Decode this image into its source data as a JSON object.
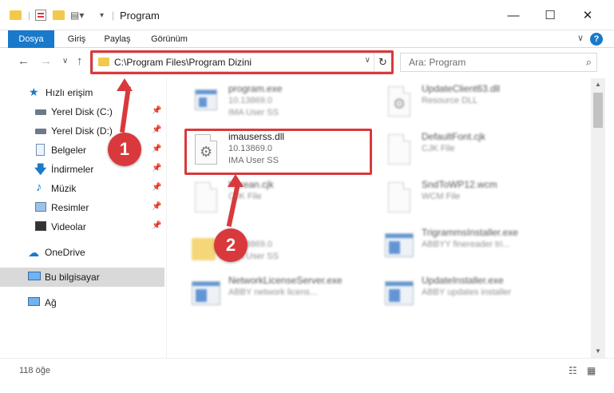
{
  "window": {
    "title": "Program",
    "minimize": "—",
    "maximize": "☐",
    "close": "✕"
  },
  "ribbon": {
    "tabs": [
      "Dosya",
      "Giriş",
      "Paylaş",
      "Görünüm"
    ],
    "help": "?",
    "collapse": "∨"
  },
  "nav": {
    "back": "←",
    "forward": "→",
    "recent": "∨",
    "up": "↑",
    "address": "C:\\Program Files\\Program Dizini",
    "search_placeholder": "Ara: Program"
  },
  "sidebar": {
    "items": [
      {
        "label": "Hızlı erişim",
        "icon": "star-icon"
      },
      {
        "label": "Yerel Disk (C:)",
        "icon": "drive-icon",
        "pinned": true
      },
      {
        "label": "Yerel Disk (D:)",
        "icon": "drive-icon",
        "pinned": true
      },
      {
        "label": "Belgeler",
        "icon": "documents-icon",
        "pinned": true
      },
      {
        "label": "İndirmeler",
        "icon": "download-icon",
        "pinned": true
      },
      {
        "label": "Müzik",
        "icon": "music-icon",
        "pinned": true
      },
      {
        "label": "Resimler",
        "icon": "pictures-icon",
        "pinned": true
      },
      {
        "label": "Videolar",
        "icon": "videos-icon",
        "pinned": true
      },
      {
        "label": "OneDrive",
        "icon": "cloud-icon"
      },
      {
        "label": "Bu bilgisayar",
        "icon": "computer-icon",
        "selected": true
      },
      {
        "label": "Ağ",
        "icon": "network-icon"
      }
    ]
  },
  "files": [
    {
      "name": "program.exe",
      "line1": "10.13869.0",
      "line2": "IMA User SS",
      "type": "exe"
    },
    {
      "name": "UpdateClient63.dll",
      "line1": "Resource DLL",
      "line2": "",
      "type": "dll"
    },
    {
      "name": "imauserss.dll",
      "line1": "10.13869.0",
      "line2": "IMA User SS",
      "type": "dll",
      "highlighted": true
    },
    {
      "name": "DefaultFont.cjk",
      "line1": "CJK File",
      "line2": "",
      "type": "page"
    },
    {
      "name": "Korean.cjk",
      "line1": "CJK File",
      "line2": "",
      "type": "page"
    },
    {
      "name": "SndToWP12.wcm",
      "line1": "WCM File",
      "line2": "",
      "type": "page"
    },
    {
      "name": "",
      "line1": "10.13869.0",
      "line2": "IMA User SS",
      "type": "folder"
    },
    {
      "name": "TrigrammsInstaller.exe",
      "line1": "ABBYY finereader tri...",
      "line2": "",
      "type": "app"
    },
    {
      "name": "NetworkLicenseServer.exe",
      "line1": "ABBY network licens...",
      "line2": "",
      "type": "app"
    },
    {
      "name": "UpdateInstaller.exe",
      "line1": "ABBY updates installer",
      "line2": "",
      "type": "app"
    }
  ],
  "status": {
    "count": "118 öğe"
  },
  "annotations": {
    "step1": "1",
    "step2": "2"
  },
  "colors": {
    "accent": "#1979ca",
    "highlight": "#d9393c"
  }
}
